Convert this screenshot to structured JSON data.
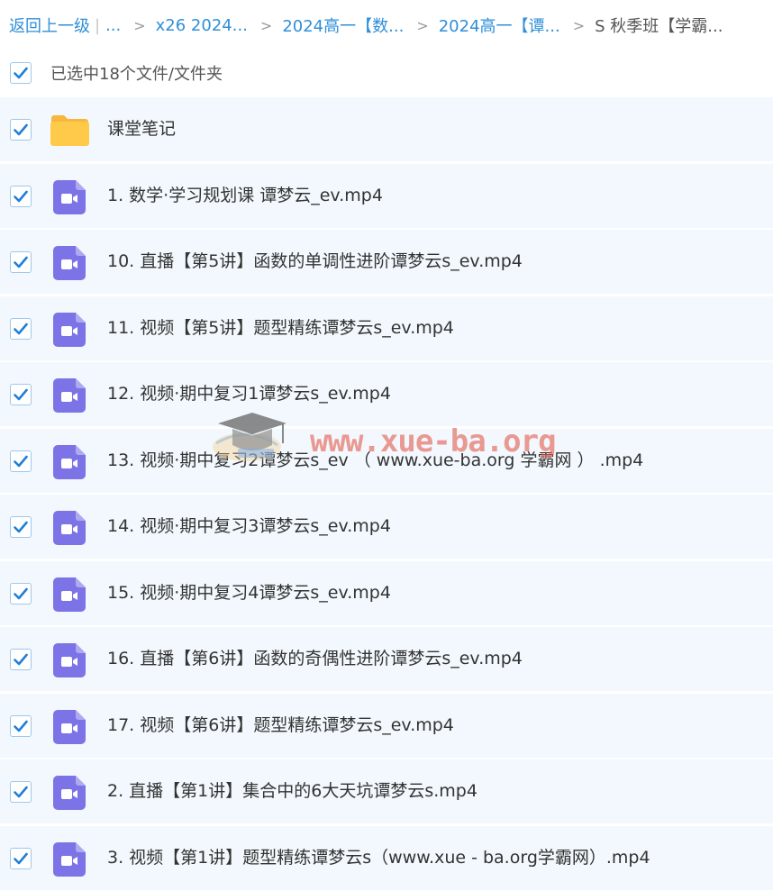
{
  "breadcrumb": {
    "back_label": "返回上一级",
    "pipe": "|",
    "more": "...",
    "separator": ">",
    "items": [
      {
        "label": "x26 2024..."
      },
      {
        "label": "2024高一【数..."
      },
      {
        "label": "2024高一【谭..."
      }
    ],
    "current": "S 秋季班【学霸..."
  },
  "selection": {
    "checked": true,
    "label": "已选中18个文件/文件夹"
  },
  "files": [
    {
      "name": "课堂笔记",
      "type": "folder",
      "checked": true
    },
    {
      "name": "1. 数学·学习规划课 谭梦云_ev.mp4",
      "type": "video",
      "checked": true
    },
    {
      "name": "10. 直播【第5讲】函数的单调性进阶谭梦云s_ev.mp4",
      "type": "video",
      "checked": true
    },
    {
      "name": "11. 视频【第5讲】题型精练谭梦云s_ev.mp4",
      "type": "video",
      "checked": true
    },
    {
      "name": "12. 视频·期中复习1谭梦云s_ev.mp4",
      "type": "video",
      "checked": true
    },
    {
      "name": "13. 视频·期中复习2谭梦云s_ev （ www.xue-ba.org 学霸网 ） .mp4",
      "type": "video",
      "checked": true
    },
    {
      "name": "14. 视频·期中复习3谭梦云s_ev.mp4",
      "type": "video",
      "checked": true
    },
    {
      "name": "15. 视频·期中复习4谭梦云s_ev.mp4",
      "type": "video",
      "checked": true
    },
    {
      "name": "16. 直播【第6讲】函数的奇偶性进阶谭梦云s_ev.mp4",
      "type": "video",
      "checked": true
    },
    {
      "name": "17. 视频【第6讲】题型精练谭梦云s_ev.mp4",
      "type": "video",
      "checked": true
    },
    {
      "name": "2. 直播【第1讲】集合中的6大天坑谭梦云s.mp4",
      "type": "video",
      "checked": true
    },
    {
      "name": "3. 视频【第1讲】题型精练谭梦云s（www.xue - ba.org学霸网）.mp4",
      "type": "video",
      "checked": true
    }
  ],
  "watermark": {
    "text": "www.xue-ba.org"
  },
  "colors": {
    "accent": "#2f8fd8",
    "row_background": "#f2f8fd",
    "row_divider": "#ffffff",
    "video_icon": "#7c73e6",
    "folder_icon": "#ffc94a",
    "checkmark": "#1f7fd6"
  },
  "icons": {
    "checkbox": "checkmark-icon",
    "folder": "folder-icon",
    "video": "video-file-icon",
    "watermark": "graduation-cap-icon"
  }
}
